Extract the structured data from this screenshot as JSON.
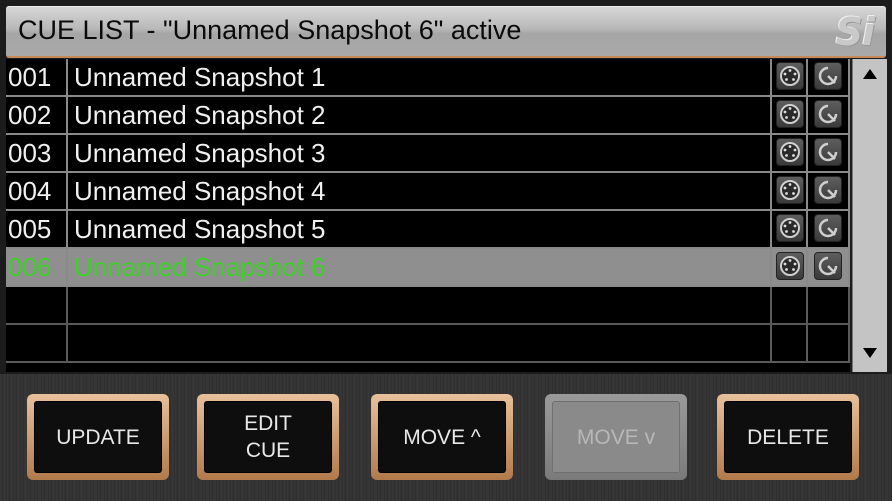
{
  "header": {
    "title": "CUE LIST - \"Unnamed Snapshot 6\" active",
    "logo": "Si"
  },
  "cue_list": {
    "rows": [
      {
        "number": "001",
        "name": "Unnamed Snapshot 1",
        "active": false
      },
      {
        "number": "002",
        "name": "Unnamed Snapshot 2",
        "active": false
      },
      {
        "number": "003",
        "name": "Unnamed Snapshot 3",
        "active": false
      },
      {
        "number": "004",
        "name": "Unnamed Snapshot 4",
        "active": false
      },
      {
        "number": "005",
        "name": "Unnamed Snapshot 5",
        "active": false
      },
      {
        "number": "006",
        "name": "Unnamed Snapshot 6",
        "active": true
      }
    ],
    "empty_rows": 2,
    "icons": [
      "midi-connector-icon",
      "recall-icon"
    ],
    "active_color": "#3fcf2a"
  },
  "scrollbar": {
    "up_icon": "triangle-up-icon",
    "down_icon": "triangle-down-icon"
  },
  "buttons": [
    {
      "label": "UPDATE",
      "enabled": true
    },
    {
      "label": "EDIT\nCUE",
      "enabled": true
    },
    {
      "label": "MOVE ^",
      "enabled": true
    },
    {
      "label": "MOVE v",
      "enabled": false
    },
    {
      "label": "DELETE",
      "enabled": true
    }
  ],
  "colors": {
    "button_frame": "#c58a55",
    "title_bar": "#b9b9b9"
  }
}
